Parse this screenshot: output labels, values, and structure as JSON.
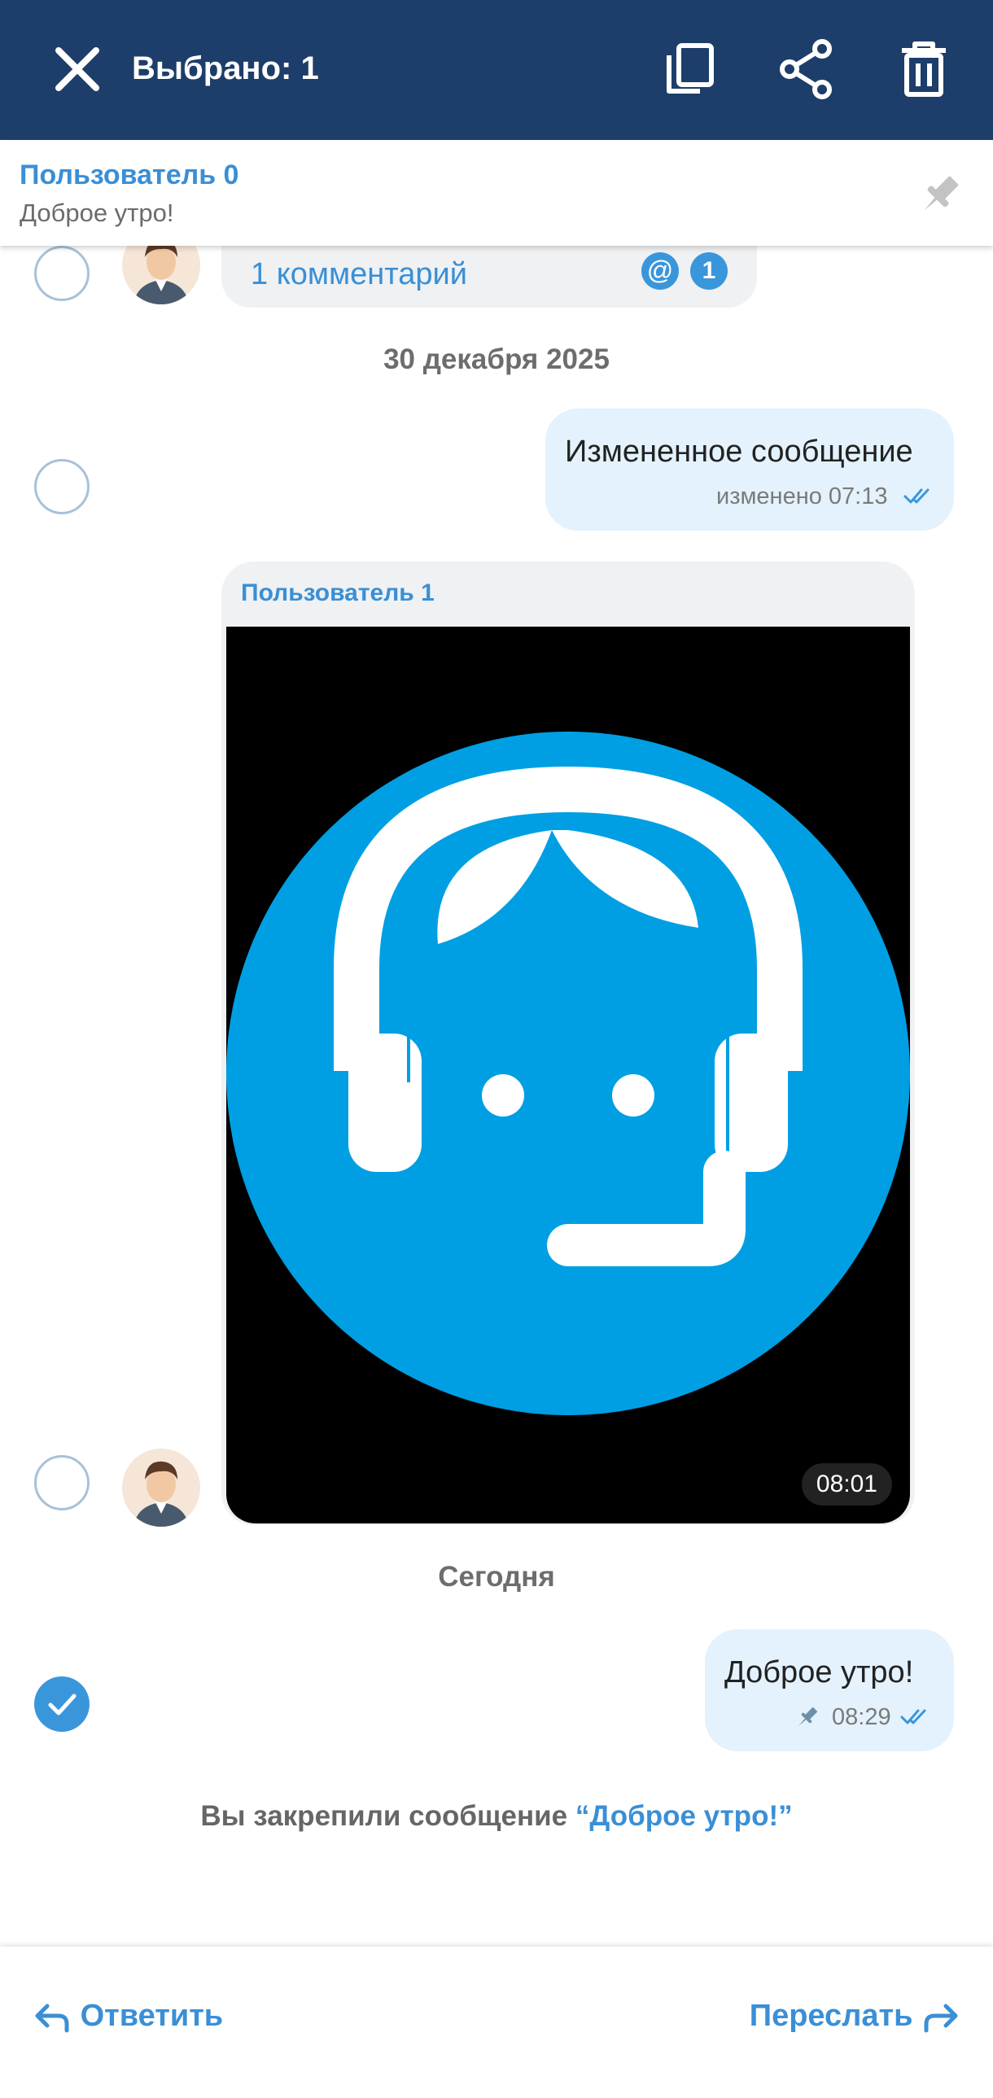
{
  "topbar": {
    "title": "Выбрано: 1",
    "icons": [
      "close-icon",
      "copy-icon",
      "share-icon",
      "trash-icon"
    ],
    "bg_color": "#1d3e6a"
  },
  "pinned": {
    "author": "Пользователь 0",
    "text": "Доброе утро!",
    "icon": "pin-icon"
  },
  "chat": {
    "thread_comments": {
      "label": "1 комментарий",
      "mention_badge": "@",
      "count_badge": "1"
    },
    "date_separator_1": "30 декабря 2025",
    "msg_edited": {
      "text": "Измененное сообщение",
      "meta": "изменено 07:13"
    },
    "media_msg": {
      "author": "Пользователь 1",
      "time": "08:01",
      "image": "support-headset-avatar"
    },
    "date_separator_2": "Сегодня",
    "msg_pinned": {
      "text": "Доброе утро!",
      "time": "08:29"
    },
    "system": {
      "prefix": "Вы закрепили сообщение ",
      "quote": "“Доброе утро!”"
    }
  },
  "bottombar": {
    "reply_label": "Ответить",
    "forward_label": "Переслать"
  },
  "colors": {
    "accent": "#3a8fd6",
    "outgoing_bubble": "#e3f2fc",
    "incoming_bubble": "#eff1f3",
    "logo_blue": "#009fe3"
  }
}
